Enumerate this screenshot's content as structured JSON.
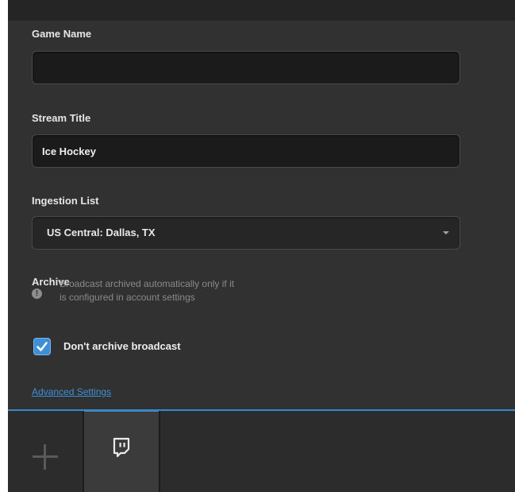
{
  "form": {
    "game_name": {
      "label": "Game Name",
      "value": "",
      "placeholder": ""
    },
    "stream_title": {
      "label": "Stream Title",
      "value": "Ice Hockey"
    },
    "ingestion_list": {
      "label": "Ingestion List",
      "selected": "US Central: Dallas, TX"
    },
    "archive": {
      "label": "Archive",
      "info_text": "Broadcast archived automatically only if it\nis configured in account settings",
      "checkbox_label": "Don't archive broadcast",
      "checked": true
    },
    "advanced_link": "Advanced Settings"
  },
  "tabs": {
    "add_icon": "plus-icon",
    "active_tab_icon": "twitch-icon"
  },
  "colors": {
    "accent": "#3b88c9",
    "background": "#313131",
    "field_bg": "#1b1b1b"
  }
}
